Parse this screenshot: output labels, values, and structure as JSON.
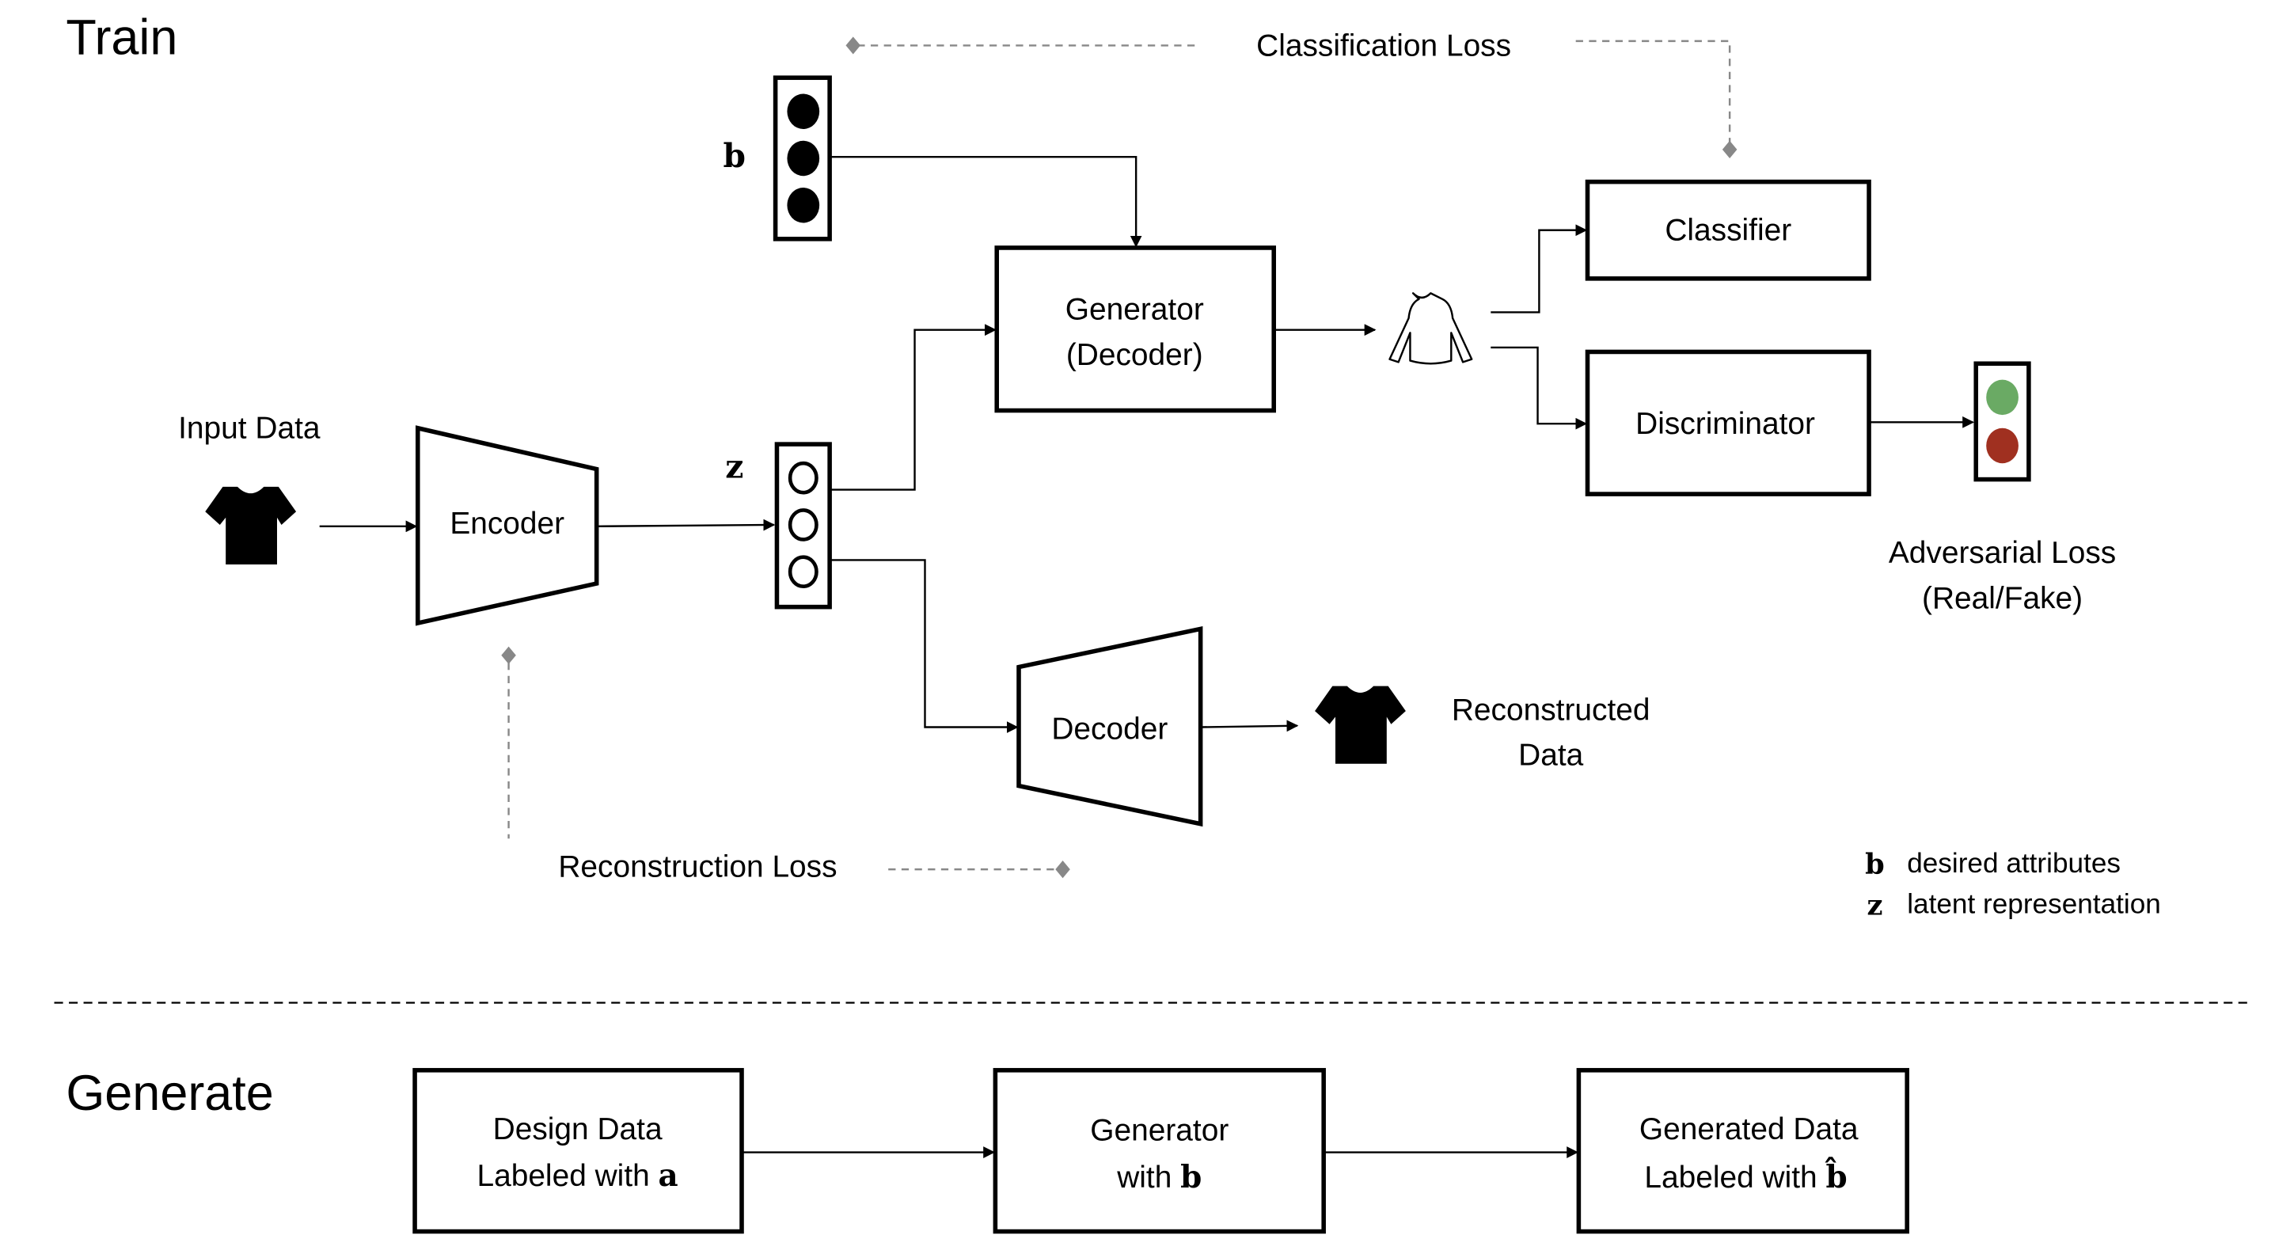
{
  "sections": {
    "train": "Train",
    "generate": "Generate"
  },
  "train": {
    "input_label": "Input Data",
    "encoder": "Encoder",
    "z_symbol": "z",
    "b_symbol": "b",
    "generator_line1": "Generator",
    "generator_line2": "(Decoder)",
    "decoder": "Decoder",
    "classifier": "Classifier",
    "discriminator": "Discriminator",
    "reconstructed_line1": "Reconstructed",
    "reconstructed_line2": "Data",
    "classification_loss": "Classification Loss",
    "reconstruction_loss": "Reconstruction Loss",
    "adversarial_line1": "Adversarial Loss",
    "adversarial_line2": "(Real/Fake)",
    "adversarial_colors": {
      "real": "#6aaa64",
      "fake": "#a03020"
    }
  },
  "legend": [
    {
      "symbol": "b",
      "text": "desired attributes"
    },
    {
      "symbol": "z",
      "text": "latent representation"
    }
  ],
  "generate": {
    "box1_line1": "Design Data",
    "box1_line2": "Labeled with ",
    "box1_symbol": "a",
    "box2_line1": "Generator",
    "box2_line2": "with ",
    "box2_symbol": "b",
    "box3_line1": "Generated Data",
    "box3_line2": "Labeled with ",
    "box3_symbol": "b̂"
  },
  "icons": {
    "input": "tshirt-icon",
    "reconstructed": "tshirt-icon",
    "generated": "long-sleeve-shirt-icon"
  }
}
